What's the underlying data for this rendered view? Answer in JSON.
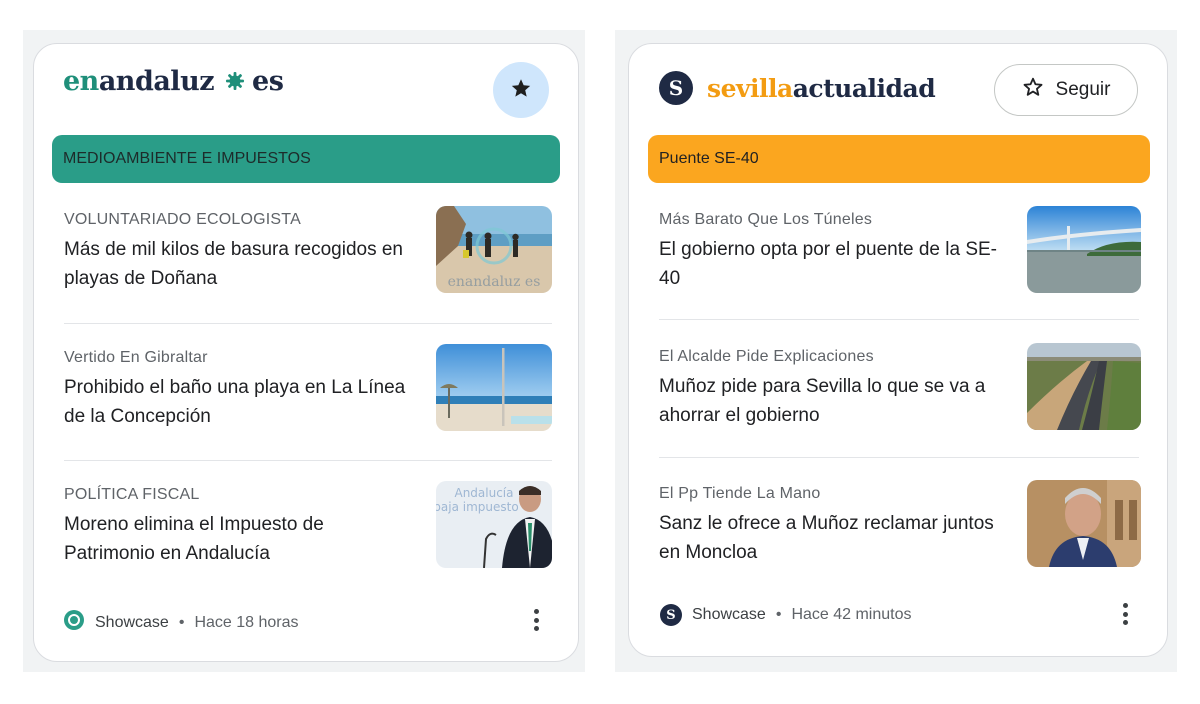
{
  "colors": {
    "teal_band": "#2a9d88",
    "orange_band": "#fba61f",
    "teal_logo": "#1f8f7a",
    "navy": "#1f2a44",
    "orange_logo": "#f39c12"
  },
  "left_card": {
    "logo": {
      "part1": "en",
      "part2": "andaluz",
      "part3": "es",
      "mark_icon": "sun-gear-icon"
    },
    "star_button_icon": "star-filled-icon",
    "band_label": "MEDIOAMBIENTE E IMPUESTOS",
    "items": [
      {
        "kicker": "VOLUNTARIADO ECOLOGISTA",
        "title": "Más de mil kilos de basura recogidos en playas de Doñana",
        "thumb_watermark": "enandaluz es"
      },
      {
        "kicker": "Vertido En Gibraltar",
        "title": "Prohibido el baño una playa en La Línea de la Concepción"
      },
      {
        "kicker": "POLÍTICA FISCAL",
        "title": "Moreno elimina el Impuesto de Patrimonio en Andalucía",
        "thumb_text1": "Andalucía",
        "thumb_text2": "baja impuesto"
      }
    ],
    "footer": {
      "source": "Showcase",
      "separator": "•",
      "time": "Hace 18 horas"
    }
  },
  "right_card": {
    "logo": {
      "badge": "S",
      "part1": "sevilla",
      "part2": "actualidad"
    },
    "follow_label": "Seguir",
    "follow_icon": "star-outline-icon",
    "band_label": "Puente SE-40",
    "items": [
      {
        "kicker": "Más Barato Que Los Túneles",
        "title": "El gobierno opta por el puente de la SE-40"
      },
      {
        "kicker": "El Alcalde Pide Explicaciones",
        "title": "Muñoz pide para Sevilla lo que se va a ahorrar el gobierno"
      },
      {
        "kicker": "El Pp Tiende La Mano",
        "title": "Sanz le ofrece a Muñoz reclamar juntos en Moncloa"
      }
    ],
    "footer": {
      "source": "Showcase",
      "separator": "•",
      "time": "Hace 42 minutos"
    }
  }
}
